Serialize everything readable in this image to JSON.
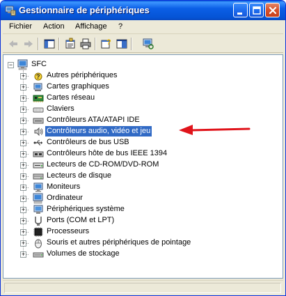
{
  "window": {
    "title": "Gestionnaire de périphériques",
    "accent_color": "#0553d4",
    "selection_color": "#316ac5",
    "annotation_color": "#e0141b"
  },
  "menu": {
    "items": [
      "Fichier",
      "Action",
      "Affichage",
      "?"
    ]
  },
  "toolbar": {
    "buttons": [
      "back-arrow-icon",
      "forward-arrow-icon",
      "console-tree-icon",
      "properties-icon",
      "print-icon",
      "help-icon",
      "show-hide-icon",
      "scan-hardware-icon"
    ]
  },
  "tree": {
    "root": "SFC",
    "root_expander": "−",
    "expander": "+",
    "selected_index": 5,
    "items": [
      {
        "label": "Autres périphériques",
        "icon": "unknown-device-icon"
      },
      {
        "label": "Cartes graphiques",
        "icon": "display-adapter-icon"
      },
      {
        "label": "Cartes réseau",
        "icon": "network-card-icon"
      },
      {
        "label": "Claviers",
        "icon": "keyboard-icon"
      },
      {
        "label": "Contrôleurs ATA/ATAPI IDE",
        "icon": "ide-controller-icon"
      },
      {
        "label": "Contrôleurs audio, vidéo et jeu",
        "icon": "sound-icon"
      },
      {
        "label": "Contrôleurs de bus USB",
        "icon": "usb-icon"
      },
      {
        "label": "Contrôleurs hôte de bus IEEE 1394",
        "icon": "firewire-icon"
      },
      {
        "label": "Lecteurs de CD-ROM/DVD-ROM",
        "icon": "cdrom-icon"
      },
      {
        "label": "Lecteurs de disque",
        "icon": "disk-drive-icon"
      },
      {
        "label": "Moniteurs",
        "icon": "monitor-icon"
      },
      {
        "label": "Ordinateur",
        "icon": "computer-icon"
      },
      {
        "label": "Périphériques système",
        "icon": "system-device-icon"
      },
      {
        "label": "Ports (COM et LPT)",
        "icon": "port-icon"
      },
      {
        "label": "Processeurs",
        "icon": "processor-icon"
      },
      {
        "label": "Souris et autres périphériques de pointage",
        "icon": "mouse-icon"
      },
      {
        "label": "Volumes de stockage",
        "icon": "storage-volume-icon"
      }
    ]
  }
}
